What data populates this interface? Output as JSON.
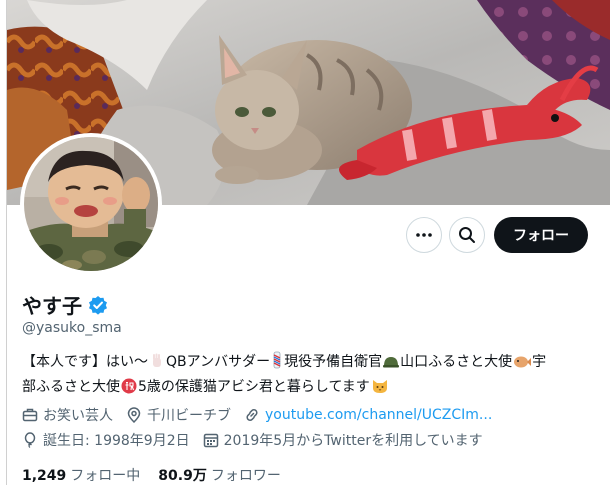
{
  "profile": {
    "display_name": "やす子",
    "handle": "@yasuko_sma",
    "verified_icon": "verified-badge-icon",
    "bio_parts": {
      "p1": "【本人です】はい〜",
      "p2": "QBアンバサダー",
      "p3": "現役予備自衛官",
      "p4": "山口ふるさと大使",
      "p5": "宇",
      "p6": "部ふるさと大使",
      "p7": "5歳の保護猫アビシ君と暮らしてます"
    },
    "meta": {
      "occupation": "お笑い芸人",
      "location": "千川ビーチブ",
      "website": "youtube.com/channel/UCZCIm...",
      "birthday": "誕生日: 1998年9月2日",
      "joined": "2019年5月からTwitterを利用しています"
    },
    "stats": {
      "following_count": "1,249",
      "following_label": "フォロー中",
      "followers_count": "80.9万",
      "followers_label": "フォロワー"
    }
  },
  "actions": {
    "more_icon": "more-horizontal-icon",
    "search_icon": "search-icon",
    "follow_label": "フォロー"
  },
  "colors": {
    "accent_link": "#1d9bf0",
    "verified": "#1d9bf0",
    "follow_button_bg": "#0f1419",
    "muted_text": "#536471"
  }
}
